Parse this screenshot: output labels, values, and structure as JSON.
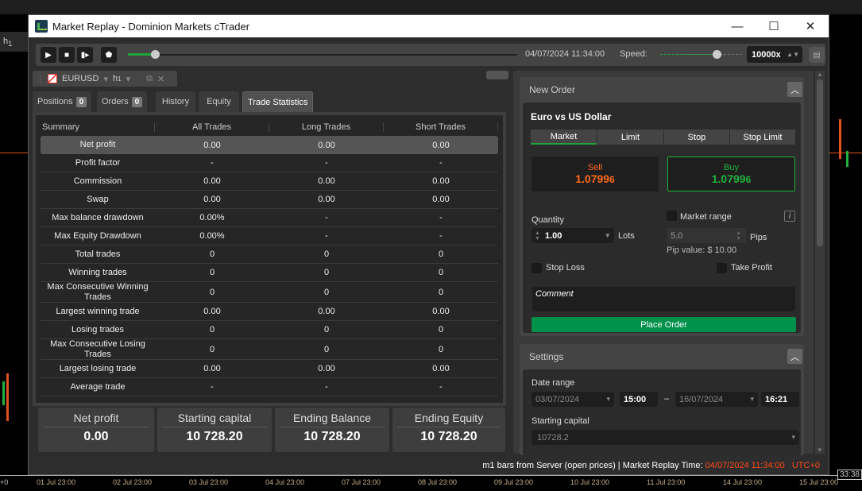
{
  "window": {
    "title": "Market Replay - Dominion Markets cTrader",
    "minimize": "—",
    "maximize": "☐",
    "close": "✕"
  },
  "background": {
    "timeframe_label": "h",
    "timeframe_sub": "1",
    "axis_left": "+0",
    "time_ticks": [
      "01 Jul 23:00",
      "02 Jul 23:00",
      "03 Jul 23:00",
      "04 Jul 23:00",
      "07 Jul 23:00",
      "08 Jul 23:00",
      "09 Jul 23:00",
      "10 Jul 23:00",
      "11 Jul 23:00",
      "14 Jul 23:00",
      "15 Jul 23:00"
    ],
    "time_cursor": "33:38"
  },
  "replay": {
    "progress": 0.07,
    "current_time": "04/07/2024 11:34:00",
    "speed_label": "Speed:",
    "speed_level": 0.69,
    "speed_value": "10000x"
  },
  "symbol": {
    "name": "EURUSD",
    "timeframe": "h",
    "timeframe_sub": "1"
  },
  "tabs": [
    {
      "label": "Positions",
      "count": "0"
    },
    {
      "label": "Orders",
      "count": "0"
    },
    {
      "label": "History"
    },
    {
      "label": "Equity"
    },
    {
      "label": "Trade Statistics"
    }
  ],
  "stats": {
    "headers": [
      "Summary",
      "All Trades",
      "Long Trades",
      "Short Trades"
    ],
    "rows": [
      [
        "Net profit",
        "0.00",
        "0.00",
        "0.00"
      ],
      [
        "Profit factor",
        "-",
        "-",
        "-"
      ],
      [
        "Commission",
        "0.00",
        "0.00",
        "0.00"
      ],
      [
        "Swap",
        "0.00",
        "0.00",
        "0.00"
      ],
      [
        "Max balance drawdown",
        "0.00%",
        "-",
        "-"
      ],
      [
        "Max Equity Drawdown",
        "0.00%",
        "-",
        "-"
      ],
      [
        "Total trades",
        "0",
        "0",
        "0"
      ],
      [
        "Winning trades",
        "0",
        "0",
        "0"
      ],
      [
        "Max Consecutive Winning Trades",
        "0",
        "0",
        "0"
      ],
      [
        "Largest winning trade",
        "0.00",
        "0.00",
        "0.00"
      ],
      [
        "Losing trades",
        "0",
        "0",
        "0"
      ],
      [
        "Max Consecutive Losing Trades",
        "0",
        "0",
        "0"
      ],
      [
        "Largest losing trade",
        "0.00",
        "0.00",
        "0.00"
      ],
      [
        "Average trade",
        "-",
        "-",
        "-"
      ]
    ]
  },
  "summary_cards": [
    {
      "title": "Net profit",
      "value": "0.00"
    },
    {
      "title": "Starting capital",
      "value": "10 728.20"
    },
    {
      "title": "Ending Balance",
      "value": "10 728.20"
    },
    {
      "title": "Ending Equity",
      "value": "10 728.20"
    }
  ],
  "new_order": {
    "title": "New Order",
    "symbol_name": "Euro vs US Dollar",
    "order_types": [
      "Market",
      "Limit",
      "Stop",
      "Stop Limit"
    ],
    "sell_label": "Sell",
    "sell_price": "1.0799",
    "sell_pip": "6",
    "buy_label": "Buy",
    "buy_price": "1.0799",
    "buy_pip": "6",
    "quantity_label": "Quantity",
    "quantity": "1.00",
    "lots_label": "Lots",
    "market_range_label": "Market range",
    "range_value": "5.0",
    "pips_label": "Pips",
    "pip_value": "Pip value: $ 10.00",
    "stop_loss": "Stop Loss",
    "take_profit": "Take Profit",
    "comment_placeholder": "Comment",
    "place_order": "Place Order",
    "info": "i",
    "colors": {
      "sell": "#ff6a1a",
      "buy": "#21b33c",
      "place_order": "#00914a"
    }
  },
  "settings": {
    "title": "Settings",
    "date_range_label": "Date range",
    "start_date": "03/07/2024",
    "start_time": "15:00",
    "dash": "–",
    "end_date": "16/07/2024",
    "end_time": "16:21",
    "capital_label": "Starting capital",
    "capital": "10728.2"
  },
  "status": {
    "source": "m1 bars from Server (open prices)  |  Market Replay Time:",
    "time": "04/07/2024 11:34:00",
    "tz": "UTC+0"
  }
}
